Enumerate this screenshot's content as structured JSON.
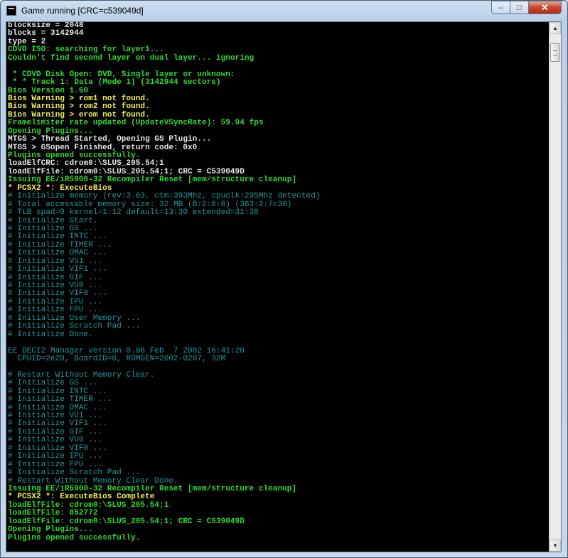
{
  "window": {
    "title": "Game running [CRC=c539049d]",
    "minimize_glyph": "–",
    "maximize_glyph": "□",
    "close_glyph": "✕"
  },
  "scrollbar": {
    "up_glyph": "▲",
    "down_glyph": "▼"
  },
  "colors": {
    "white": "#e6e6e6",
    "green": "#2fdc2f",
    "yellow": "#f2ef5a",
    "teal": "#1f9c9c"
  },
  "console": {
    "lines": [
      {
        "text": "blocksize = 2048",
        "color": "white"
      },
      {
        "text": "blocks = 3142944",
        "color": "white"
      },
      {
        "text": "type = 2",
        "color": "white"
      },
      {
        "text": "CDVD ISO: searching for layer1...",
        "color": "green"
      },
      {
        "text": "Couldn't find second layer on dual layer... ignoring",
        "color": "green"
      },
      {
        "text": "",
        "color": "white"
      },
      {
        "text": " * CDVD Disk Open: DVD, Single layer or unknown:",
        "color": "green"
      },
      {
        "text": " * * Track 1: Data (Mode 1) (3142944 sectors)",
        "color": "green"
      },
      {
        "text": "Bios Version 1.60",
        "color": "green"
      },
      {
        "text": "Bios Warning > rom1 not found.",
        "color": "yellow"
      },
      {
        "text": "Bios Warning > rom2 not found.",
        "color": "yellow"
      },
      {
        "text": "Bios Warning > erom not found.",
        "color": "yellow"
      },
      {
        "text": "Framelimiter rate updated (UpdateVSyncRate): 59.94 fps",
        "color": "green"
      },
      {
        "text": "Opening Plugins...",
        "color": "green"
      },
      {
        "text": "MTGS > Thread Started, Opening GS Plugin...",
        "color": "white"
      },
      {
        "text": "MTGS > GSopen Finished, return code: 0x0",
        "color": "white"
      },
      {
        "text": "Plugins opened successfully.",
        "color": "green"
      },
      {
        "text": "loadElfCRC: cdrom0:\\SLUS_205.54;1",
        "color": "white"
      },
      {
        "text": "loadElfFile: cdrom0:\\SLUS_205.54;1; CRC = C539049D",
        "color": "white"
      },
      {
        "text": "Issuing EE/iR5900-32 Recompiler Reset [mem/structure cleanup]",
        "color": "green"
      },
      {
        "text": "* PCSX2 *: ExecuteBios",
        "color": "yellow"
      },
      {
        "text": "# Initialize memory (rev:3.63, ctm:393Mhz, cpuclk:295Mhz detected)",
        "color": "teal"
      },
      {
        "text": "# Total accessable memory size: 32 MB (B:2:8:0) (363:2:7c30)",
        "color": "teal"
      },
      {
        "text": "# TLB spad=0 kernel=1:12 default=13:30 extended=31:38",
        "color": "teal"
      },
      {
        "text": "# Initialize Start.",
        "color": "teal"
      },
      {
        "text": "# Initialize GS ...",
        "color": "teal"
      },
      {
        "text": "# Initialize INTC ...",
        "color": "teal"
      },
      {
        "text": "# Initialize TIMER ...",
        "color": "teal"
      },
      {
        "text": "# Initialize DMAC ...",
        "color": "teal"
      },
      {
        "text": "# Initialize VU1 ...",
        "color": "teal"
      },
      {
        "text": "# Initialize VIF1 ...",
        "color": "teal"
      },
      {
        "text": "# Initialize GIF ...",
        "color": "teal"
      },
      {
        "text": "# Initialize VU0 ...",
        "color": "teal"
      },
      {
        "text": "# Initialize VIF0 ...",
        "color": "teal"
      },
      {
        "text": "# Initialize IPU ...",
        "color": "teal"
      },
      {
        "text": "# Initialize FPU ...",
        "color": "teal"
      },
      {
        "text": "# Initialize User Memory ...",
        "color": "teal"
      },
      {
        "text": "# Initialize Scratch Pad ...",
        "color": "teal"
      },
      {
        "text": "# Initialize Done.",
        "color": "teal"
      },
      {
        "text": "",
        "color": "teal"
      },
      {
        "text": "EE DECI2 Manager version 0.06 Feb  7 2002 16:41:20",
        "color": "teal"
      },
      {
        "text": "  CPUID=2e20, BoardID=0, ROMGEN=2002-0207, 32M",
        "color": "teal"
      },
      {
        "text": "",
        "color": "teal"
      },
      {
        "text": "# Restart Without Memory Clear.",
        "color": "teal"
      },
      {
        "text": "# Initialize GS ...",
        "color": "teal"
      },
      {
        "text": "# Initialize INTC ...",
        "color": "teal"
      },
      {
        "text": "# Initialize TIMER ...",
        "color": "teal"
      },
      {
        "text": "# Initialize DMAC ...",
        "color": "teal"
      },
      {
        "text": "# Initialize VU1 ...",
        "color": "teal"
      },
      {
        "text": "# Initialize VIF1 ...",
        "color": "teal"
      },
      {
        "text": "# Initialize GIF ...",
        "color": "teal"
      },
      {
        "text": "# Initialize VU0 ...",
        "color": "teal"
      },
      {
        "text": "# Initialize VIF0 ...",
        "color": "teal"
      },
      {
        "text": "# Initialize IPU ...",
        "color": "teal"
      },
      {
        "text": "# Initialize FPU ...",
        "color": "teal"
      },
      {
        "text": "# Initialize Scratch Pad ...",
        "color": "teal"
      },
      {
        "text": "# Restart Without Memory Clear Done.",
        "color": "teal"
      },
      {
        "text": "Issuing EE/iR5900-32 Recompiler Reset [mem/structure cleanup]",
        "color": "green"
      },
      {
        "text": "* PCSX2 *: ExecuteBios Complete",
        "color": "yellow"
      },
      {
        "text": "loadElfFile: cdrom0:\\SLUS_205.54;1",
        "color": "green"
      },
      {
        "text": "loadElfFile: 852772",
        "color": "green"
      },
      {
        "text": "loadElfFile: cdrom0:\\SLUS_205.54;1; CRC = C539049D",
        "color": "green"
      },
      {
        "text": "Opening Plugins...",
        "color": "green"
      },
      {
        "text": "Plugins opened successfully.",
        "color": "green"
      }
    ]
  }
}
